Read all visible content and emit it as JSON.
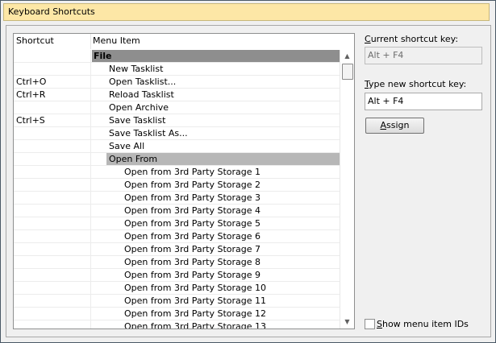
{
  "window": {
    "title": "Keyboard Shortcuts"
  },
  "list": {
    "columns": [
      "Shortcut",
      "Menu Item"
    ],
    "rows": [
      {
        "shortcut": "",
        "item": "File",
        "indent": 0,
        "state": "group-selected"
      },
      {
        "shortcut": "",
        "item": "New Tasklist",
        "indent": 1,
        "state": ""
      },
      {
        "shortcut": "Ctrl+O",
        "item": "Open Tasklist...",
        "indent": 1,
        "state": ""
      },
      {
        "shortcut": "Ctrl+R",
        "item": "Reload Tasklist",
        "indent": 1,
        "state": ""
      },
      {
        "shortcut": "",
        "item": "Open Archive",
        "indent": 1,
        "state": ""
      },
      {
        "shortcut": "Ctrl+S",
        "item": "Save Tasklist",
        "indent": 1,
        "state": ""
      },
      {
        "shortcut": "",
        "item": "Save Tasklist As...",
        "indent": 1,
        "state": ""
      },
      {
        "shortcut": "",
        "item": "Save All",
        "indent": 1,
        "state": ""
      },
      {
        "shortcut": "",
        "item": "Open From",
        "indent": 1,
        "state": "submenu-selected"
      },
      {
        "shortcut": "",
        "item": "Open from 3rd Party Storage 1",
        "indent": 2,
        "state": ""
      },
      {
        "shortcut": "",
        "item": "Open from 3rd Party Storage 2",
        "indent": 2,
        "state": ""
      },
      {
        "shortcut": "",
        "item": "Open from 3rd Party Storage 3",
        "indent": 2,
        "state": ""
      },
      {
        "shortcut": "",
        "item": "Open from 3rd Party Storage 4",
        "indent": 2,
        "state": ""
      },
      {
        "shortcut": "",
        "item": "Open from 3rd Party Storage 5",
        "indent": 2,
        "state": ""
      },
      {
        "shortcut": "",
        "item": "Open from 3rd Party Storage 6",
        "indent": 2,
        "state": ""
      },
      {
        "shortcut": "",
        "item": "Open from 3rd Party Storage 7",
        "indent": 2,
        "state": ""
      },
      {
        "shortcut": "",
        "item": "Open from 3rd Party Storage 8",
        "indent": 2,
        "state": ""
      },
      {
        "shortcut": "",
        "item": "Open from 3rd Party Storage 9",
        "indent": 2,
        "state": ""
      },
      {
        "shortcut": "",
        "item": "Open from 3rd Party Storage 10",
        "indent": 2,
        "state": ""
      },
      {
        "shortcut": "",
        "item": "Open from 3rd Party Storage 11",
        "indent": 2,
        "state": ""
      },
      {
        "shortcut": "",
        "item": "Open from 3rd Party Storage 12",
        "indent": 2,
        "state": ""
      },
      {
        "shortcut": "",
        "item": "Open from 3rd Party Storage 13",
        "indent": 2,
        "state": ""
      }
    ]
  },
  "current": {
    "label": "Current shortcut key:",
    "value": "Alt + F4"
  },
  "new_key": {
    "label": "Type new shortcut key:",
    "value": "Alt + F4"
  },
  "assign_button": {
    "label": "Assign"
  },
  "show_ids": {
    "label": "Show menu item IDs",
    "checked": false
  },
  "icons": {
    "scroll_up": "chevron-up-icon",
    "scroll_down": "chevron-down-icon"
  }
}
